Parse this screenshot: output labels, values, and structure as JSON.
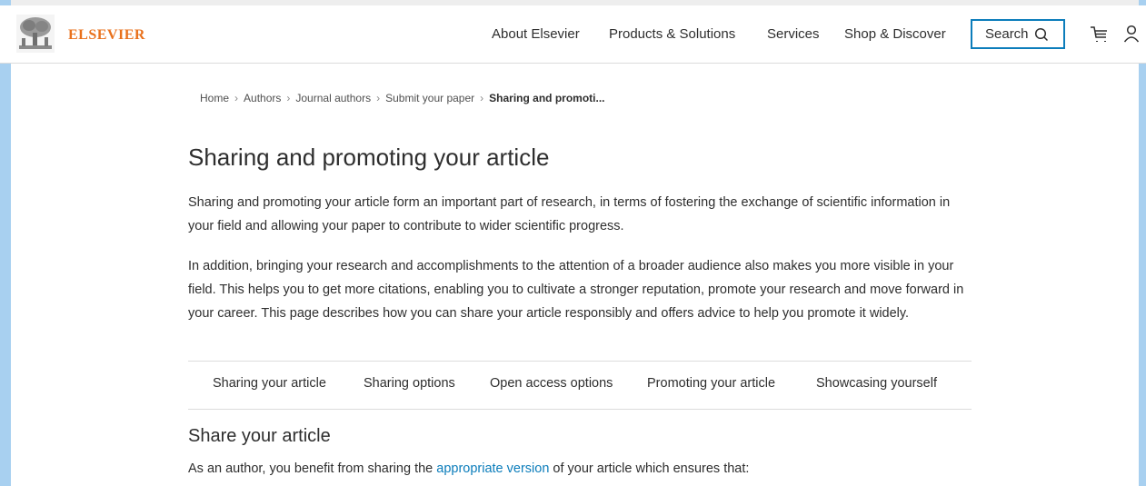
{
  "header": {
    "logo_text": "ELSEVIER",
    "nav": [
      "About Elsevier",
      "Products & Solutions",
      "Services",
      "Shop & Discover"
    ],
    "search_label": "Search",
    "icons": [
      "search-icon",
      "cart-icon",
      "user-icon"
    ]
  },
  "breadcrumb": {
    "items": [
      "Home",
      "Authors",
      "Journal authors",
      "Submit your paper"
    ],
    "current": "Sharing and promoti..."
  },
  "main": {
    "title": "Sharing and promoting your article",
    "intro_1": "Sharing and promoting your article form an important part of research, in terms of fostering the exchange of scientific information in your field and allowing your paper to contribute to wider scientific progress.",
    "intro_2": "In addition, bringing your research and accomplishments to the attention of a broader audience also makes you more visible in your field. This helps you to get more citations, enabling you to cultivate a stronger reputation, promote your research and move forward in your career. This page describes how you can share your article responsibly and offers advice to help you promote it widely.",
    "tabs": [
      "Sharing your article",
      "Sharing options",
      "Open access options",
      "Promoting your article",
      "Showcasing yourself"
    ],
    "section_title": "Share your article",
    "section_text_before": "As an author, you benefit from sharing the ",
    "section_link": "appropriate version",
    "section_text_after": " of your article which ensures that:"
  },
  "colors": {
    "brand": "#e9711c",
    "link": "#0c7dbb",
    "side_bars": "#a8d0f0"
  }
}
